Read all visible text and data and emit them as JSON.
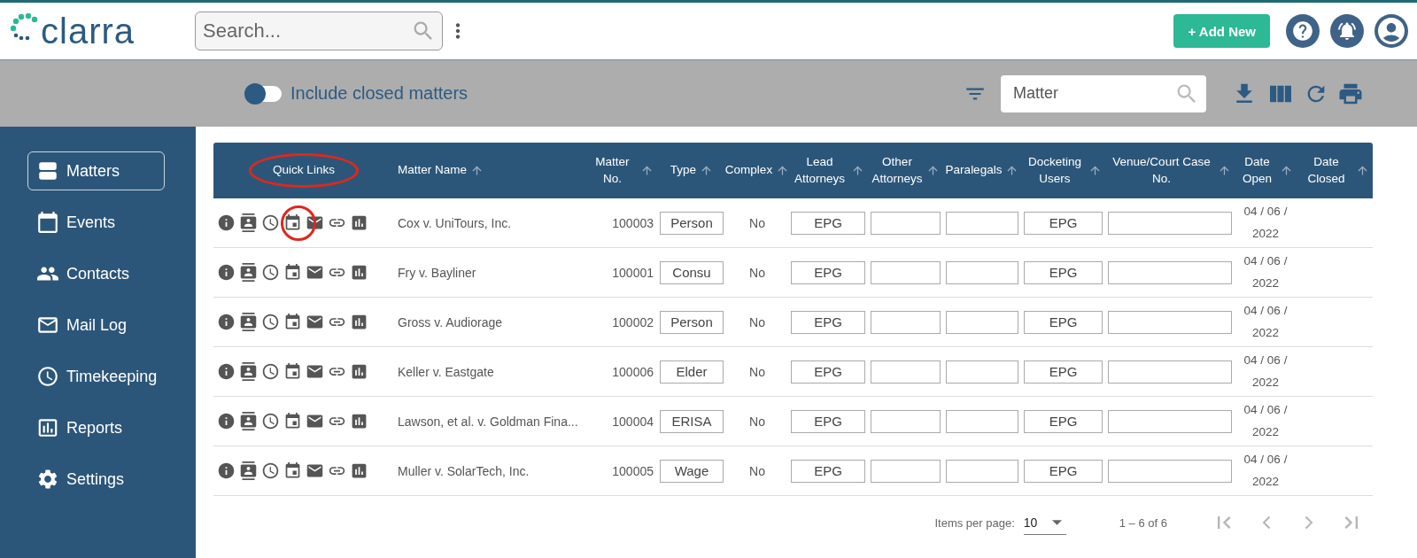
{
  "logo": {
    "text": "clarra"
  },
  "search": {
    "placeholder": "Search..."
  },
  "header": {
    "add_button": "+ Add New"
  },
  "toolbar": {
    "include_closed": {
      "label": "Include closed matters",
      "on": false
    },
    "filter_field": {
      "value": "Matter"
    }
  },
  "sidebar": {
    "items": [
      {
        "label": "Matters",
        "kind": "matters",
        "selected": true
      },
      {
        "label": "Events",
        "kind": "events",
        "selected": false
      },
      {
        "label": "Contacts",
        "kind": "contacts",
        "selected": false
      },
      {
        "label": "Mail Log",
        "kind": "mail",
        "selected": false
      },
      {
        "label": "Timekeeping",
        "kind": "time",
        "selected": false
      },
      {
        "label": "Reports",
        "kind": "reports",
        "selected": false
      },
      {
        "label": "Settings",
        "kind": "settings",
        "selected": false
      }
    ]
  },
  "table": {
    "quick_links": {
      "label": "Quick Links",
      "circled": true
    },
    "columns": [
      "Matter Name",
      "Matter No.",
      "Type",
      "Complex",
      "Lead Attorneys",
      "Other Attorneys",
      "Paralegals",
      "Docketing Users",
      "Venue/Court Case No.",
      "Date Open",
      "Date Closed"
    ],
    "rows": [
      {
        "calendar_circled": true,
        "name": "Cox v. UniTours, Inc.",
        "number": "100003",
        "type": "Person",
        "complex": "No",
        "lead": "EPG",
        "other": "",
        "paralegals": "",
        "docketing": "EPG",
        "venue": "",
        "date_open": "04 / 06 / 2022",
        "date_closed": ""
      },
      {
        "calendar_circled": false,
        "name": "Fry v. Bayliner",
        "number": "100001",
        "type": "Consu",
        "complex": "No",
        "lead": "EPG",
        "other": "",
        "paralegals": "",
        "docketing": "EPG",
        "venue": "",
        "date_open": "04 / 06 / 2022",
        "date_closed": ""
      },
      {
        "calendar_circled": false,
        "name": "Gross v. Audiorage",
        "number": "100002",
        "type": "Person",
        "complex": "No",
        "lead": "EPG",
        "other": "",
        "paralegals": "",
        "docketing": "EPG",
        "venue": "",
        "date_open": "04 / 06 / 2022",
        "date_closed": ""
      },
      {
        "calendar_circled": false,
        "name": "Keller v. Eastgate",
        "number": "100006",
        "type": "Elder",
        "complex": "No",
        "lead": "EPG",
        "other": "",
        "paralegals": "",
        "docketing": "EPG",
        "venue": "",
        "date_open": "04 / 06 / 2022",
        "date_closed": ""
      },
      {
        "calendar_circled": false,
        "name": "Lawson, et al. v. Goldman Fina...",
        "number": "100004",
        "type": "ERISA",
        "complex": "No",
        "lead": "EPG",
        "other": "",
        "paralegals": "",
        "docketing": "EPG",
        "venue": "",
        "date_open": "04 / 06 / 2022",
        "date_closed": ""
      },
      {
        "calendar_circled": false,
        "name": "Muller v. SolarTech, Inc.",
        "number": "100005",
        "type": "Wage",
        "complex": "No",
        "lead": "EPG",
        "other": "",
        "paralegals": "",
        "docketing": "EPG",
        "venue": "",
        "date_open": "04 / 06 / 2022",
        "date_closed": ""
      }
    ]
  },
  "pagination": {
    "label": "Items per page:",
    "page_size": "10",
    "range": "1 – 6 of 6",
    "first_disabled": true,
    "prev_disabled": true,
    "next_disabled": true,
    "last_disabled": true
  }
}
